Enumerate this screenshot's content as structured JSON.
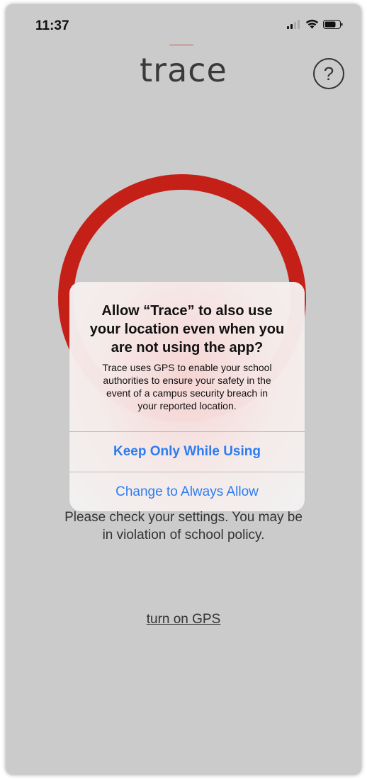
{
  "status_bar": {
    "time": "11:37",
    "icons": [
      "signal-icon",
      "wifi-icon",
      "battery-icon"
    ]
  },
  "header": {
    "title": "trace",
    "help_label": "?"
  },
  "background": {
    "ring_color": "#c42018",
    "message_lines": [
      "Please check your settings. You may be",
      "in violation of school policy."
    ],
    "link_text": "turn on GPS"
  },
  "alert": {
    "title_lines": [
      "Allow “Trace” to also use",
      "your location even when you",
      "are not using the app?"
    ],
    "message_lines": [
      "Trace uses GPS to enable your school",
      "authorities to ensure your safety in the",
      "event of a campus security breach in",
      "your reported location."
    ],
    "primary_button": "Keep Only While Using",
    "secondary_button": "Change to Always Allow",
    "button_color": "#2d7cf0"
  }
}
